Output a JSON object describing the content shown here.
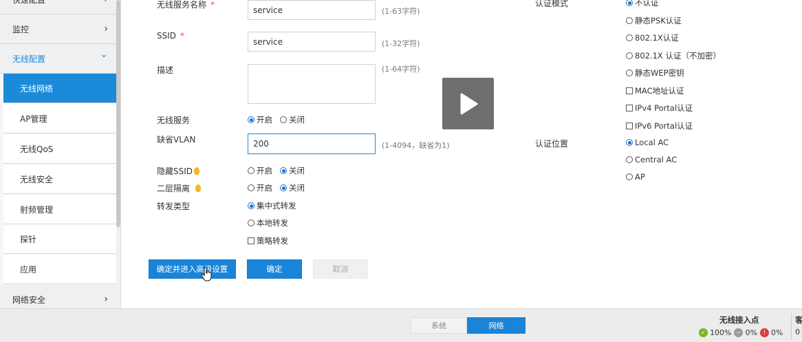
{
  "sidebar": {
    "items": [
      {
        "label": "快速配置",
        "type": "top"
      },
      {
        "label": "监控",
        "type": "top"
      },
      {
        "label": "无线配置",
        "type": "open"
      },
      {
        "label": "无线网络",
        "type": "active"
      },
      {
        "label": "AP管理",
        "type": "sub"
      },
      {
        "label": "无线QoS",
        "type": "sub"
      },
      {
        "label": "无线安全",
        "type": "sub"
      },
      {
        "label": "射频管理",
        "type": "sub"
      },
      {
        "label": "探针",
        "type": "sub"
      },
      {
        "label": "应用",
        "type": "sub"
      },
      {
        "label": "网络安全",
        "type": "top"
      }
    ]
  },
  "form": {
    "service_name": {
      "label": "无线服务名称",
      "required": "*",
      "value": "service",
      "hint": "(1-63字符)"
    },
    "ssid": {
      "label": "SSID",
      "required": "*",
      "value": "service",
      "hint": "(1-32字符)"
    },
    "description": {
      "label": "描述",
      "value": "",
      "hint": "(1-64字符)"
    },
    "wireless_service": {
      "label": "无线服务",
      "options": [
        "开启",
        "关闭"
      ],
      "selected": "开启"
    },
    "default_vlan": {
      "label": "缺省VLAN",
      "value": "200",
      "hint": "(1-4094，缺省为1)"
    },
    "hide_ssid": {
      "label": "隐藏SSID",
      "options": [
        "开启",
        "关闭"
      ],
      "selected": "关闭"
    },
    "layer2_isolation": {
      "label": "二层隔离",
      "options": [
        "开启",
        "关闭"
      ],
      "selected": "关闭"
    },
    "forwarding_type": {
      "label": "转发类型",
      "options": [
        "集中式转发",
        "本地转发"
      ],
      "selected": "集中式转发",
      "checkbox": "策略转发"
    },
    "auth_mode": {
      "label": "认证模式",
      "radios": [
        "不认证",
        "静态PSK认证",
        "802.1X认证",
        "802.1X 认证（不加密）",
        "静态WEP密钥"
      ],
      "selected": "不认证",
      "checkboxes": [
        "MAC地址认证",
        "IPv4 Portal认证",
        "IPv6 Portal认证"
      ]
    },
    "auth_location": {
      "label": "认证位置",
      "radios": [
        "Local AC",
        "Central AC",
        "AP"
      ],
      "selected": "Local AC"
    }
  },
  "buttons": {
    "confirm_advanced": "确定并进入高级设置",
    "confirm": "确定",
    "cancel": "取消"
  },
  "footer": {
    "tabs": [
      "系统",
      "网络"
    ],
    "active_tab": "网络",
    "status_title": "无线接入点",
    "stats": [
      {
        "value": "100%",
        "color": "#7cb227",
        "icon": "check-circle-icon"
      },
      {
        "value": "0%",
        "color": "#999999",
        "icon": "minus-circle-icon"
      },
      {
        "value": "0%",
        "color": "#e03a3a",
        "icon": "alert-circle-icon"
      }
    ],
    "cut_title": "客",
    "cut_value": "0"
  },
  "colors": {
    "accent": "#1a84d8",
    "required": "#e04c4c"
  }
}
